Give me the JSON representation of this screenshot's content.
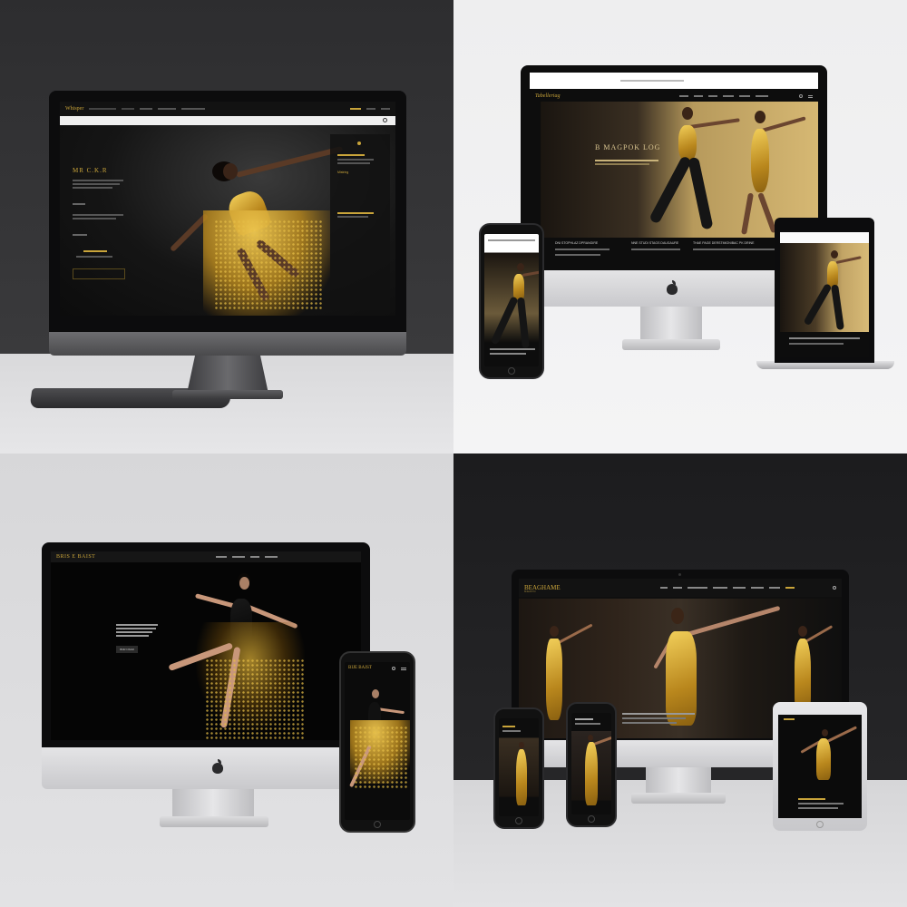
{
  "colors": {
    "gold": "#c9a43a",
    "site_background": "#0a0a0a",
    "nav_background": "#141414",
    "mockup_bg_dark": "#2d2d2f",
    "mockup_bg_light": "#f4f4f5"
  },
  "icons": [
    "apple-logo-icon",
    "search-icon",
    "menu-icon",
    "camera-icon",
    "home-button-icon"
  ],
  "q1": {
    "brand": "Whisper",
    "nav": [
      "",
      "",
      "",
      "",
      ""
    ],
    "hero_heading": "MR C.K.R",
    "sidebar_link": "Mistring",
    "cta_label": ""
  },
  "q2": {
    "brand": "Tabelleriag",
    "hero_heading": "B MAGPOK LOG",
    "sub_columns": [
      "DNI STOPHLAZ DPRANGIRE",
      "NNE STUDI STAGS DAUGAURE",
      "THAE PAGE DERSTMIONIBAC PK DRINE"
    ]
  },
  "q3": {
    "brand": "BRIS E BAIST",
    "phone_brand": "BIJE BAJST",
    "cta_label": "BNR NSAR"
  },
  "q4": {
    "brand": "BEAGHAME",
    "brand_sub": "BNEWFHU"
  }
}
